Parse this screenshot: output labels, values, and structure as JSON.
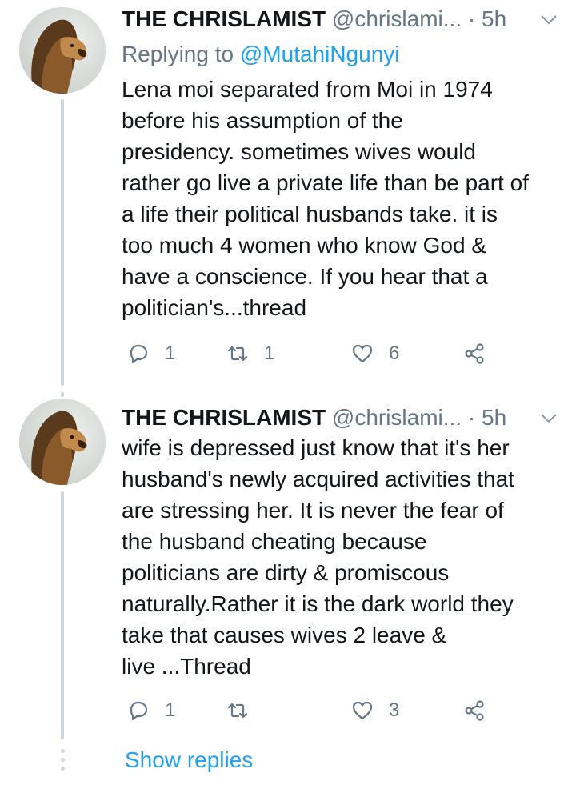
{
  "thread": [
    {
      "author": {
        "name": "THE CHRISLAMIST",
        "handle": "@chrislami...",
        "separator": "·",
        "time": "5h"
      },
      "reply_prefix": "Replying to",
      "reply_to": "@MutahiNgunyi",
      "body_lines": [
        "Lena moi separated from Moi in 1974",
        "before his assumption of the",
        "presidency. sometimes wives would",
        "rather go live a private life than be part of",
        "a life their political husbands take. it is",
        "too much 4 women who know God &",
        "have a conscience. If you hear that a",
        "politician's...thread"
      ],
      "actions": {
        "replies": "1",
        "retweets": "1",
        "likes": "6"
      }
    },
    {
      "author": {
        "name": "THE CHRISLAMIST",
        "handle": "@chrislami...",
        "separator": "·",
        "time": "5h"
      },
      "body_lines": [
        "wife is depressed just know that it's her",
        "husband's newly acquired activities that",
        "are stressing her. It is never the fear of",
        "the husband cheating because",
        "politicians are dirty & promiscous",
        "naturally.Rather it is the dark world they",
        "take that causes wives 2 leave &",
        "live ...Thread"
      ],
      "actions": {
        "replies": "1",
        "retweets": "",
        "likes": "3"
      }
    }
  ],
  "show_replies_label": "Show replies",
  "icons": {
    "reply": "reply-icon",
    "retweet": "retweet-icon",
    "like": "heart-icon",
    "share": "share-icon",
    "caret": "chevron-down-icon"
  },
  "colors": {
    "link": "#1da1f2",
    "secondary_text": "#657786",
    "primary_text": "#14171a",
    "thread_line": "#ccd6dd"
  }
}
